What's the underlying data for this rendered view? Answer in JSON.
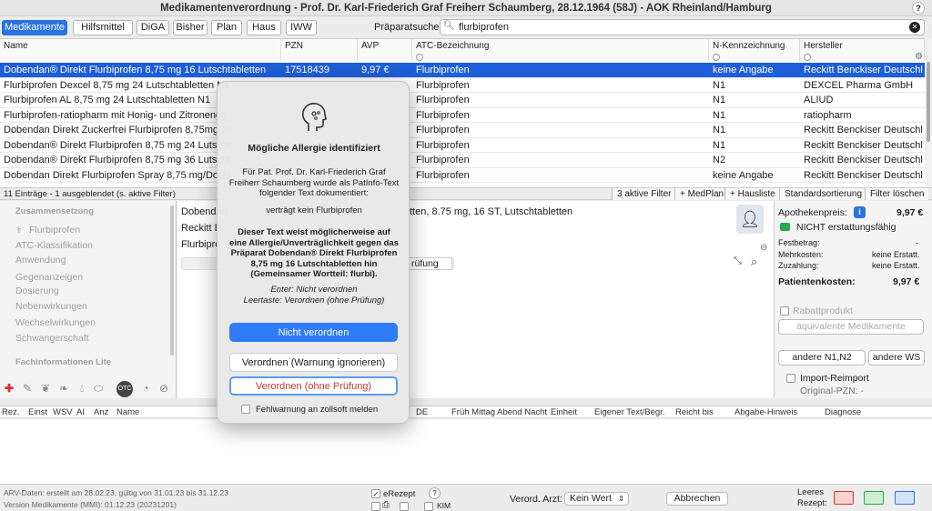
{
  "window": {
    "title": "Medikamentenverordnung - Prof. Dr. Karl-Friederich Graf Freiherr Schaumberg, 28.12.1964 (58J) - AOK Rheinland/Hamburg",
    "help": "?"
  },
  "tabs": [
    "Medikamente",
    "Hilfsmittel",
    "DiGA",
    "Bisher",
    "Plan",
    "Haus",
    "IWW"
  ],
  "search": {
    "label": "Präparatsuche:",
    "value": "flurbiprofen"
  },
  "table": {
    "headers": [
      "Name",
      "PZN",
      "AVP",
      "ATC-Bezeichnung",
      "N-Kennzeichnung",
      "Hersteller"
    ],
    "rows": [
      [
        "Dobendan® Direkt Flurbiprofen 8,75 mg 16 Lutschtabletten",
        "17518439",
        "9,97 €",
        "Flurbiprofen",
        "keine Angabe",
        "Reckitt Benckiser Deutschl"
      ],
      [
        "Flurbiprofen Dexcel 8,75 mg 24 Lutschtabletten N1",
        "",
        "",
        "Flurbiprofen",
        "N1",
        "DEXCEL Pharma GmbH"
      ],
      [
        "Flurbiprofen AL 8,75 mg 24 Lutschtabletten N1",
        "",
        "",
        "Flurbiprofen",
        "N1",
        "ALIUD"
      ],
      [
        "Flurbiprofen-ratiopharm mit Honig- und Zitronenge",
        "",
        "",
        "Flurbiprofen",
        "N1",
        "ratiopharm"
      ],
      [
        "Dobendan Direkt Zuckerfrei Flurbiprofen 8,75mg 24",
        "",
        "",
        "Flurbiprofen",
        "N1",
        "Reckitt Benckiser Deutschl"
      ],
      [
        "Dobendan® Direkt Flurbiprofen 8,75 mg 24 Lutscht",
        "",
        "",
        "Flurbiprofen",
        "N1",
        "Reckitt Benckiser Deutschl"
      ],
      [
        "Dobendan® Direkt Flurbiprofen 8,75 mg 36 Lutscht",
        "",
        "",
        "Flurbiprofen",
        "N2",
        "Reckitt Benckiser Deutschl"
      ],
      [
        "Dobendan Direkt Flurbiprofen Spray 8,75 mg/Dosis",
        "",
        "",
        "Flurbiprofen",
        "keine Angabe",
        "Reckitt Benckiser Deutschl"
      ]
    ]
  },
  "status": {
    "count": "11 Einträge - 1 ausgeblendet (s. aktive Filter)",
    "filters": "3 aktive Filter",
    "medplan": "+ MedPlan",
    "hausliste": "+ Hausliste",
    "sort": "Standardsortierung",
    "clear": "Filter löschen"
  },
  "left": {
    "items": [
      "Zusammensetzung",
      "Flurbiprofen",
      "ATC-Klassifikation",
      "Anwendung",
      "Gegenanzeigen",
      "Dosierung",
      "Nebenwirkungen",
      "Wechselwirkungen",
      "Schwangerschaft",
      "Fachinformationen Lite"
    ]
  },
  "detail": {
    "line1a": "Dobendan",
    "line1b": "tten, 8.75 mg, 16 ST, Lutschtabletten",
    "line2": "Reckitt B",
    "line3": "Flurbipro",
    "btn": "rüfung"
  },
  "right": {
    "price_label": "Apothekenpreis:",
    "price": "9,97 €",
    "erstatt": "NICHT erstattungsfähig",
    "fest_label": "Festbetrag:",
    "fest": "-",
    "mehr_label": "Mehrkosten:",
    "mehr": "keine Erstatt.",
    "zu_label": "Zuzahlung:",
    "zu": "keine Erstatt.",
    "pat_label": "Patientenkosten:",
    "pat": "9,97 €",
    "rabatt": "Rabattprodukt",
    "aequi": "äquivalente Medikamente",
    "n1n2": "andere N1,N2",
    "ws": "andere WS",
    "import": "Import-Reimport",
    "pzn": "Original-PZN: -"
  },
  "presc_headers": [
    "Rez.",
    "Einst",
    "WSV",
    "Al",
    "Anz",
    "Name",
    "DE",
    "Früh Mittag Abend Nacht",
    "Einheit",
    "Eigener Text/Begr.",
    "Reicht bis",
    "Abgabe-Hinweis",
    "Diagnose"
  ],
  "footer": {
    "arv": "ARV-Daten: erstellt am 28.02.23, gültig von 31.01.23 bis 31.12.23",
    "version": "Version Medikamente (MMI): 01.12.23 (20231201)",
    "erezept": "eRezept",
    "kim": "KIM",
    "arzt_label": "Verord. Arzt:",
    "arzt": "Kein Wert",
    "cancel": "Abbrechen",
    "leeres": "Leeres",
    "rezept": "Rezept:"
  },
  "dialog": {
    "title": "Mögliche Allergie identifiziert",
    "p1": "Für Pat. Prof. Dr. Karl-Friederich Graf Freiherr Schaumberg wurde als PatInfo-Text folgender Text dokumentiert:",
    "p2": "verträgt kein Flurbiprofen",
    "p3": "Dieser Text weist möglicherweise auf eine Allergie/Unverträglichkeit gegen das Präparat Dobendan® Direkt Flurbiprofen 8,75 mg 16 Lutschtabletten hin (Gemeinsamer Wortteil: flurbi).",
    "p4a": "Enter: Nicht verordnen",
    "p4b": "Leertaste: Verordnen (ohne Prüfung)",
    "btn1": "Nicht verordnen",
    "btn2": "Verordnen (Warnung ignorieren)",
    "btn3": "Verordnen (ohne Prüfung)",
    "check": "Fehlwarnung an zollsoft melden"
  },
  "colors": {
    "accent": "#2a73e0",
    "selection": "#1e5ed8",
    "danger": "#c0392b"
  }
}
